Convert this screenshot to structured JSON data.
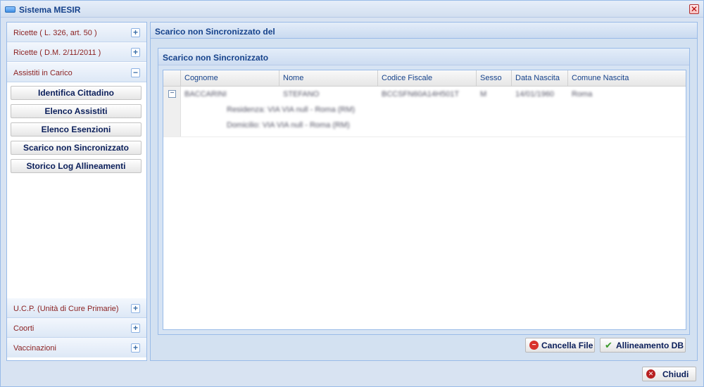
{
  "window": {
    "title": "Sistema MESIR",
    "close_glyph": "✕"
  },
  "sidebar": {
    "sections": [
      {
        "label": "Ricette ( L. 326, art. 50 )",
        "toggle": "+"
      },
      {
        "label": "Ricette ( D.M. 2/11/2011 )",
        "toggle": "+"
      },
      {
        "label": "Assistiti in Carico",
        "toggle": "−"
      },
      {
        "label": "U.C.P. (Unità di Cure Primarie)",
        "toggle": "+"
      },
      {
        "label": "Coorti",
        "toggle": "+"
      },
      {
        "label": "Vaccinazioni",
        "toggle": "+"
      }
    ],
    "buttons": [
      "Identifica Cittadino",
      "Elenco Assistiti",
      "Elenco Esenzioni",
      "Scarico non Sincronizzato",
      "Storico Log Allineamenti"
    ]
  },
  "main": {
    "title": "Scarico non Sincronizzato del",
    "fieldset_title": "Scarico non Sincronizzato",
    "grid": {
      "columns": [
        "Cognome",
        "Nome",
        "Codice Fiscale",
        "Sesso",
        "Data Nascita",
        "Comune Nascita"
      ],
      "rows": [
        {
          "cognome": "BACCARINI",
          "nome": "STEFANO",
          "codice_fiscale": "BCCSFN60A14H501T",
          "sesso": "M",
          "data_nascita": "14/01/1960",
          "comune_nascita": "Roma",
          "residenza": "Residenza: VIA VIA null - Roma (RM)",
          "domicilio": "Domicilio: VIA VIA null - Roma (RM)"
        }
      ]
    },
    "actions": {
      "cancella": "Cancella File",
      "allineamento": "Allineamento DB"
    }
  },
  "footer": {
    "chiudi": "Chiudi"
  },
  "colors": {
    "accent": "#15428b",
    "section_label": "#8a1f1f",
    "border": "#99bbe8"
  }
}
